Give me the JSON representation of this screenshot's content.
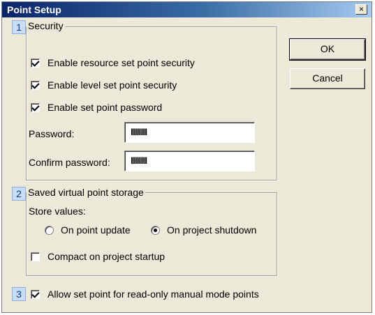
{
  "window": {
    "title": "Point Setup",
    "close_glyph": "×"
  },
  "buttons": {
    "ok": "OK",
    "cancel": "Cancel"
  },
  "security": {
    "number": "1",
    "title": "Security",
    "checkboxes": [
      {
        "label": "Enable resource set point security",
        "checked": true
      },
      {
        "label": "Enable level set point security",
        "checked": true
      },
      {
        "label": "Enable set point password",
        "checked": true
      }
    ],
    "password_label": "Password:",
    "password_value": "IIIIIIII",
    "confirm_label": "Confirm password:",
    "confirm_value": "IIIIIIII"
  },
  "storage": {
    "number": "2",
    "title": "Saved virtual point storage",
    "store_values_label": "Store values:",
    "radio_options": [
      {
        "label": "On point update",
        "selected": false
      },
      {
        "label": "On project shutdown",
        "selected": true
      }
    ],
    "compact_label": "Compact on project startup",
    "compact_checked": false
  },
  "readonly": {
    "number": "3",
    "label": "Allow set point for read-only manual mode points",
    "checked": true
  }
}
